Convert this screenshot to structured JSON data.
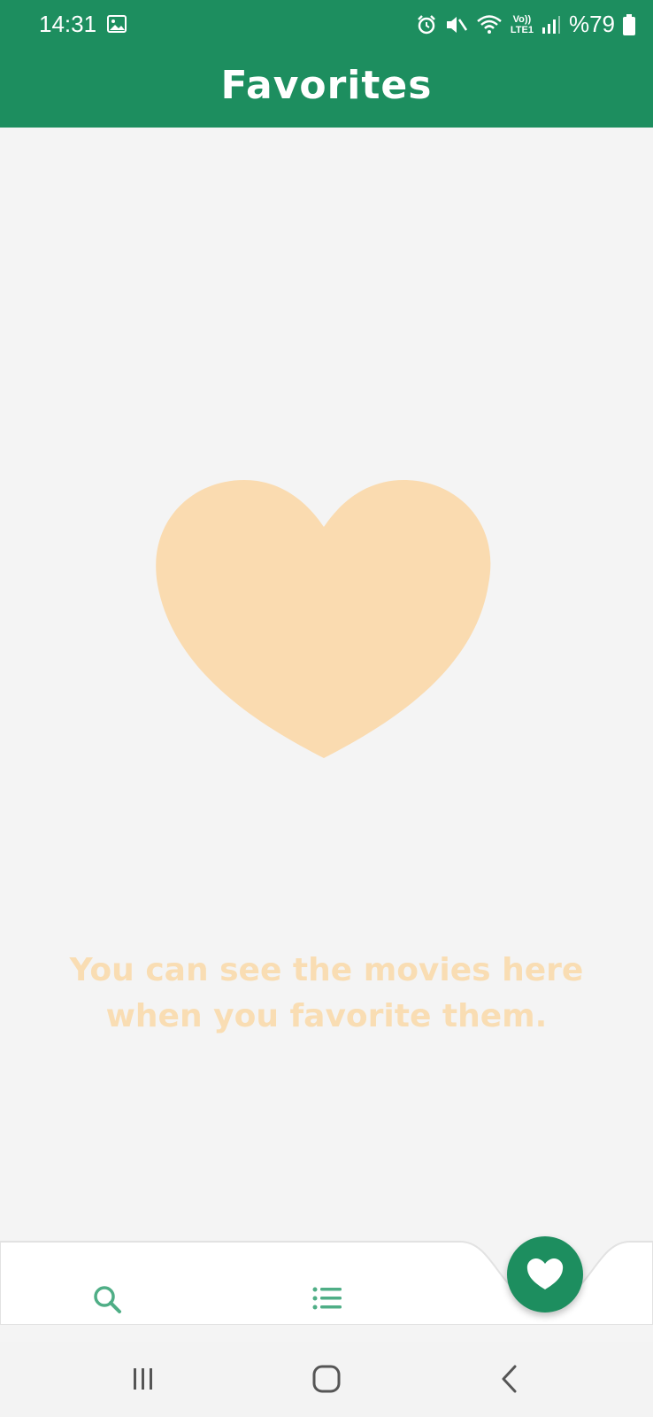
{
  "status_bar": {
    "time": "14:31",
    "volte_top": "Vo))",
    "volte_bottom": "LTE1",
    "battery": "%79",
    "icons": [
      "gallery-icon",
      "alarm-icon",
      "mute-icon",
      "wifi-icon",
      "volte-icon",
      "signal-icon",
      "battery-icon"
    ]
  },
  "app_bar": {
    "title": "Favorites"
  },
  "empty_state": {
    "line1": "You can see the movies here",
    "line2": "when you favorite them.",
    "icon": "heart-icon"
  },
  "bottom_nav": {
    "items": [
      {
        "name": "search",
        "icon": "search-icon"
      },
      {
        "name": "list",
        "icon": "list-icon"
      },
      {
        "name": "favorites",
        "icon": "heart-icon",
        "active": true
      }
    ]
  },
  "system_nav": [
    "recents-icon",
    "home-icon",
    "back-icon"
  ],
  "colors": {
    "primary": "#1d8e5f",
    "background": "#f4f4f4",
    "empty_accent": "#fadbb0",
    "nav_icon": "#4fae86"
  }
}
